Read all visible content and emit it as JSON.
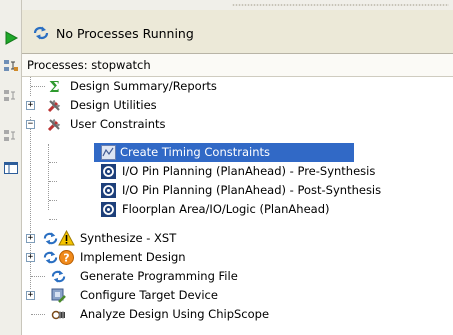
{
  "status": {
    "text": "No Processes Running",
    "icon": "refresh-icon"
  },
  "processes_header": "Processes: stopwatch",
  "tree": [
    {
      "label": "Design Summary/Reports",
      "icon": "sigma-icon"
    },
    {
      "label": "Design Utilities",
      "icon": "tools-icon"
    },
    {
      "label": "User Constraints",
      "icon": "tools-icon"
    },
    {
      "label": "Create Timing Constraints",
      "icon": "timing-icon",
      "selected": true
    },
    {
      "label": "I/O Pin Planning (PlanAhead) - Pre-Synthesis",
      "icon": "planahead-icon"
    },
    {
      "label": "I/O Pin Planning (PlanAhead) - Post-Synthesis",
      "icon": "planahead-icon"
    },
    {
      "label": "Floorplan Area/IO/Logic (PlanAhead)",
      "icon": "planahead-icon"
    },
    {
      "label": "Synthesize - XST",
      "icon": "refresh-warning-icon"
    },
    {
      "label": "Implement Design",
      "icon": "refresh-question-icon"
    },
    {
      "label": "Generate Programming File",
      "icon": "refresh-icon"
    },
    {
      "label": "Configure Target Device",
      "icon": "device-icon"
    },
    {
      "label": "Analyze Design Using ChipScope",
      "icon": "chipscope-icon"
    }
  ],
  "colors": {
    "selection": "#3169c6",
    "toolbar_bg": "#f0efe9",
    "status_bg": "#ece9d8"
  }
}
